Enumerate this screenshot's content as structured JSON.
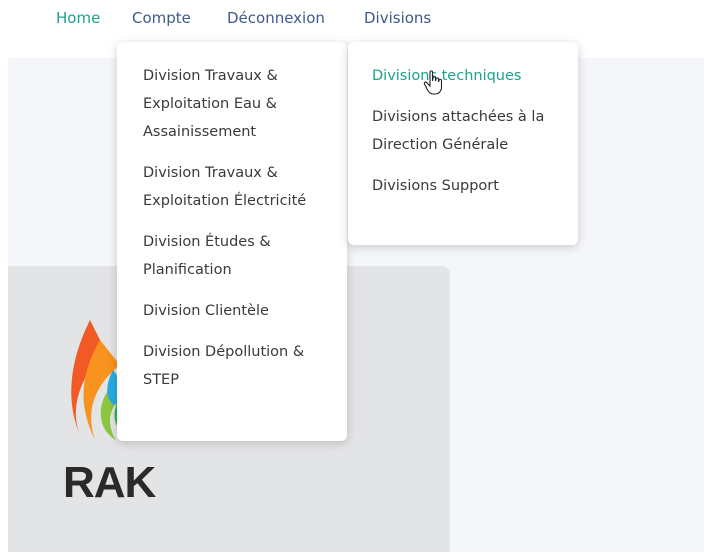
{
  "nav": {
    "items": [
      {
        "label": "Home",
        "active": true
      },
      {
        "label": "Compte",
        "active": false
      },
      {
        "label": "Déconnexion",
        "active": false
      },
      {
        "label": "Divisions",
        "active": false
      }
    ]
  },
  "divisions_menu": {
    "items": [
      {
        "label": "Division Travaux & Exploitation Eau & Assainissement"
      },
      {
        "label": "Division Travaux & Exploitation Électricité"
      },
      {
        "label": "Division Études & Planification"
      },
      {
        "label": "Division Clientèle"
      },
      {
        "label": "Division Dépollution & STEP"
      }
    ]
  },
  "submenu": {
    "items": [
      {
        "label": "Divisions techniques",
        "active": true
      },
      {
        "label": "Divisions attachées à la Direction Générale",
        "active": false
      },
      {
        "label": "Divisions Support",
        "active": false
      }
    ]
  },
  "logo": {
    "text": "RAK",
    "icon": "water-flame-logo"
  },
  "colors": {
    "accent": "#1aa38a",
    "nav": "#3d5a8f",
    "text": "#3a3a3a"
  }
}
